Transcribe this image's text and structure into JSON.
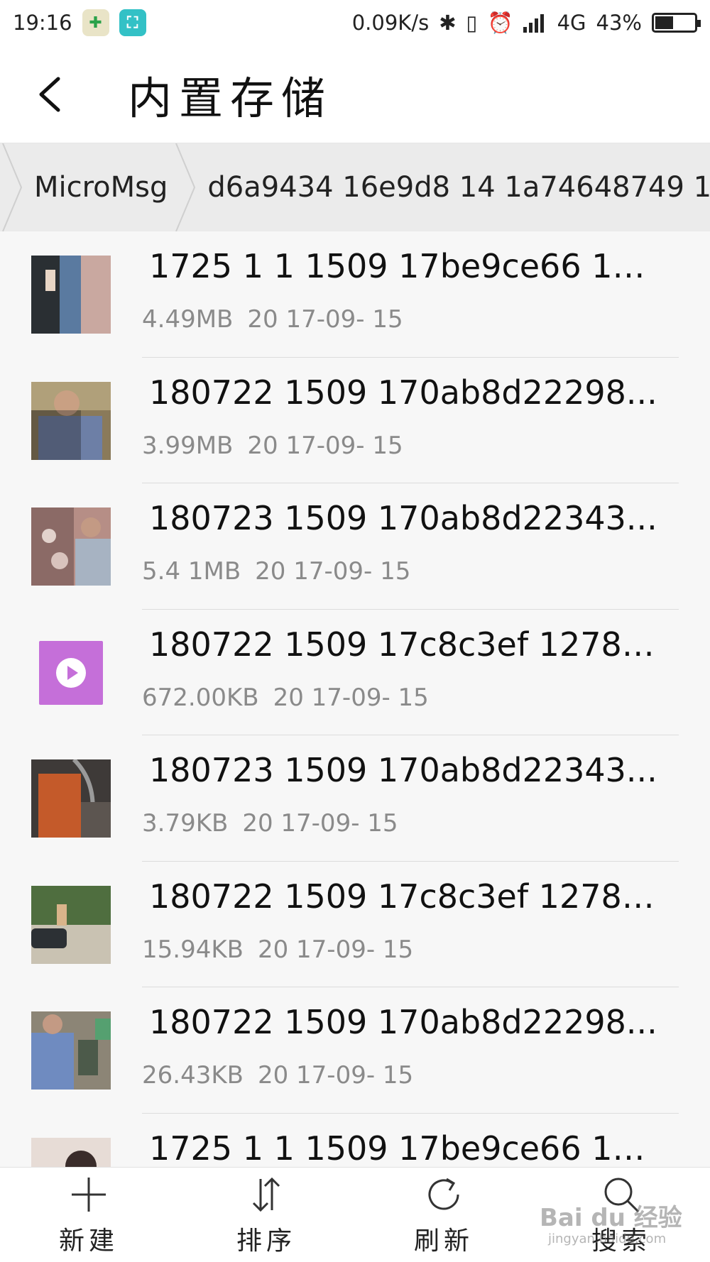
{
  "status_bar": {
    "time": "19:16",
    "net_speed": "0.09K/s",
    "network": "4G",
    "battery_percent": "43%",
    "battery_level": 0.43,
    "icons": [
      "security-app-icon",
      "screenshot-icon",
      "bluetooth-icon",
      "vibrate-icon",
      "alarm-icon",
      "signal-icon",
      "battery-icon"
    ]
  },
  "app_bar": {
    "title": "内置存储"
  },
  "breadcrumb": {
    "items": [
      "MicroMsg",
      "d6a9434 16e9d8 14 1a74648749 1"
    ]
  },
  "files": [
    {
      "name": "1725 1 1 1509 17be9ce66 174 1...",
      "size": "4.49MB",
      "date": "20 17-09- 15",
      "thumb": "photo"
    },
    {
      "name": "180722 1509 170ab8d22298...",
      "size": "3.99MB",
      "date": "20 17-09- 15",
      "thumb": "photo"
    },
    {
      "name": "180723 1509 170ab8d22343...",
      "size": "5.4 1MB",
      "date": "20 17-09- 15",
      "thumb": "photo"
    },
    {
      "name": "180722 1509 17c8c3ef 12786...",
      "size": "672.00KB",
      "date": "20 17-09- 15",
      "thumb": "video"
    },
    {
      "name": "180723 1509 170ab8d22343...",
      "size": "3.79KB",
      "date": "20 17-09- 15",
      "thumb": "photo"
    },
    {
      "name": "180722 1509 17c8c3ef 12786...",
      "size": "15.94KB",
      "date": "20 17-09- 15",
      "thumb": "photo"
    },
    {
      "name": "180722 1509 170ab8d22298...",
      "size": "26.43KB",
      "date": "20 17-09- 15",
      "thumb": "photo"
    },
    {
      "name": "1725 1 1 1509 17be9ce66 174 1...",
      "size": "",
      "date": "",
      "thumb": "photo"
    }
  ],
  "toolbar": {
    "new_label": "新建",
    "sort_label": "排序",
    "refresh_label": "刷新",
    "search_label": "搜索"
  },
  "colors": {
    "video_thumb": "#c56fd9",
    "meta_text": "#8a8a8a"
  }
}
